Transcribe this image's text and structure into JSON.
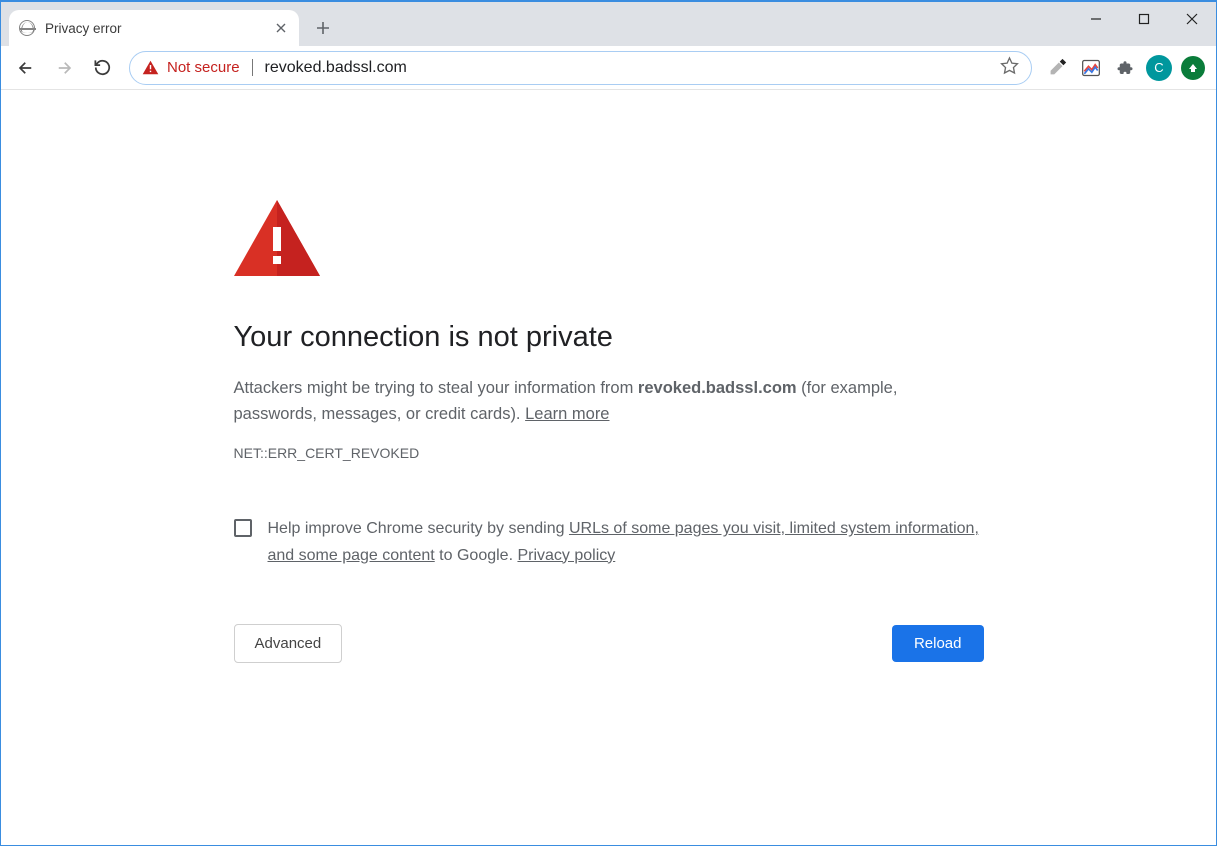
{
  "tab": {
    "title": "Privacy error"
  },
  "addressbar": {
    "security_label": "Not secure",
    "url": "revoked.badssl.com"
  },
  "avatar_letter": "C",
  "page": {
    "heading": "Your connection is not private",
    "body_pre": "Attackers might be trying to steal your information from ",
    "body_domain": "revoked.badssl.com",
    "body_post": " (for example, passwords, messages, or credit cards). ",
    "learn_more": "Learn more",
    "error_code": "NET::ERR_CERT_REVOKED",
    "optin_pre": "Help improve Chrome security by sending ",
    "optin_link1": "URLs of some pages you visit, limited system information, and some page content",
    "optin_mid": " to Google. ",
    "optin_link2": "Privacy policy",
    "advanced_label": "Advanced",
    "reload_label": "Reload"
  }
}
